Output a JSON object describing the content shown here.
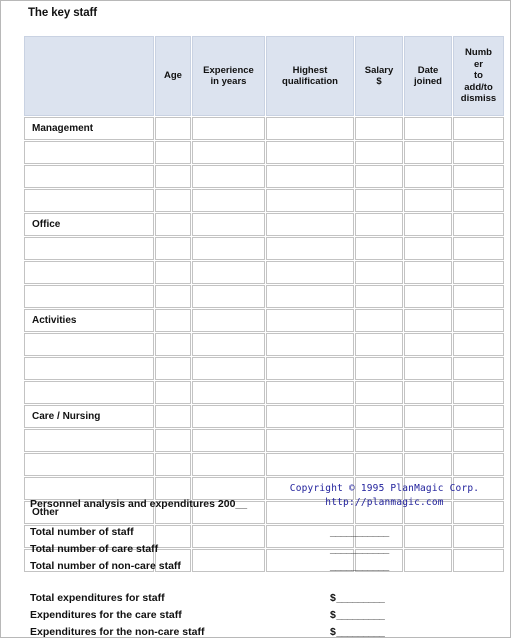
{
  "page": {
    "title": "The key staff"
  },
  "table": {
    "headers": [
      "",
      "Age",
      "Experience\nin years",
      "Highest\nqualification",
      "Salary\n$",
      "Date\njoined",
      "Number\nto\nadd/to\ndismiss"
    ],
    "header_lines": [
      [
        ""
      ],
      [
        "Age"
      ],
      [
        "Experience",
        "in years"
      ],
      [
        "Highest",
        "qualification"
      ],
      [
        "Salary",
        "$"
      ],
      [
        "Date",
        "joined"
      ],
      [
        "Numb",
        "er",
        "to",
        "add/to",
        "dismiss"
      ]
    ],
    "groups": [
      {
        "label": "Management",
        "blank_rows": 3
      },
      {
        "label": "Office",
        "blank_rows": 3
      },
      {
        "label": "Activities",
        "blank_rows": 3
      },
      {
        "label": "Care / Nursing",
        "blank_rows": 3
      },
      {
        "label": "Other",
        "blank_rows": 2
      }
    ],
    "column_count": 7,
    "header_bg": "#dce3ef",
    "border_color": "#c3c3c3"
  },
  "copyright": {
    "line1": "Copyright © 1995 PlanMagic Corp.",
    "line2": "http://planmagic.com",
    "color": "#21219c"
  },
  "analysis": {
    "title": "Personnel analysis and expenditures 200__",
    "counts": [
      {
        "label": "Total number of staff",
        "blank": "___________"
      },
      {
        "label": "Total number of care staff",
        "blank": "___________"
      },
      {
        "label": "Total number of non-care staff",
        "blank": "___________"
      }
    ],
    "expenditures": [
      {
        "label": "Total expenditures for staff",
        "currency": "$",
        "blank": "_________"
      },
      {
        "label": "Expenditures for the care staff",
        "currency": "$",
        "blank": "_________"
      },
      {
        "label": "Expenditures for the non-care staff",
        "currency": "$",
        "blank": "_________"
      }
    ]
  }
}
